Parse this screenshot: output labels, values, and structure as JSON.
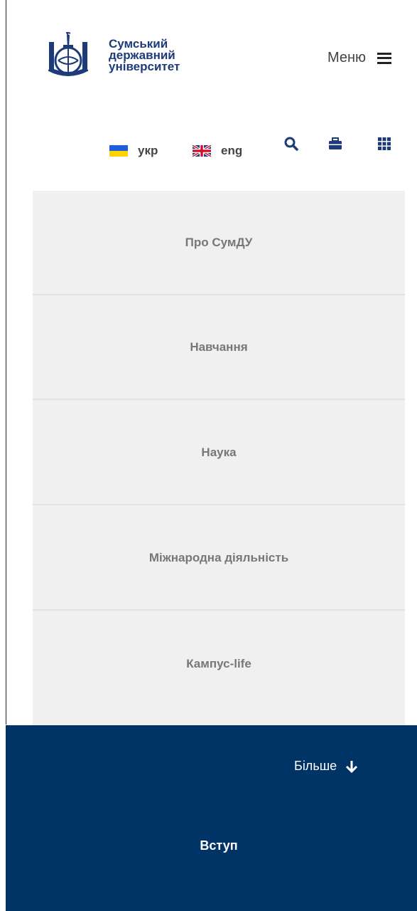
{
  "brand": {
    "line1": "Сумський",
    "line2": "державний",
    "line3": "університет",
    "color": "#1d3b78"
  },
  "header": {
    "menu_label": "Меню",
    "menu_icon": "hamburger-icon"
  },
  "toolbar": {
    "lang_ua": "укр",
    "lang_en": "eng",
    "icons": [
      "search-icon",
      "briefcase-icon",
      "grid-icon"
    ]
  },
  "nav": {
    "items": [
      "Про СумДУ",
      "Навчання",
      "Наука",
      "Міжнародна діяльність",
      "Кампус-life"
    ]
  },
  "footer": {
    "more_label": "Більше",
    "more_icon": "arrow-down-icon",
    "enroll_label": "Вступ",
    "background": "#003366"
  }
}
